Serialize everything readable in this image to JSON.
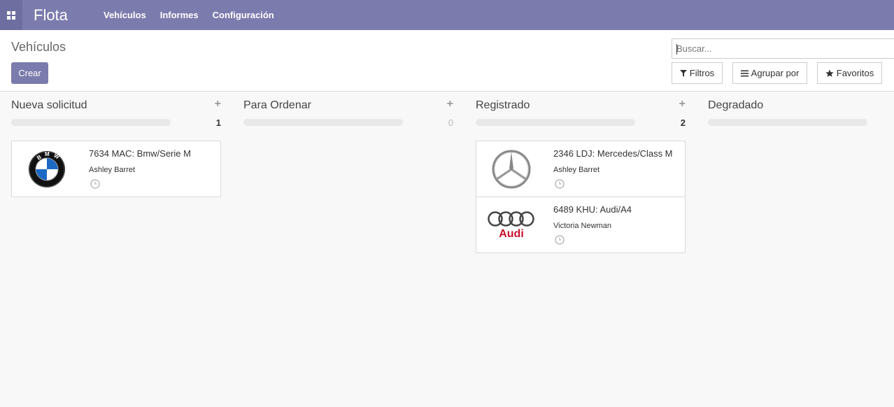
{
  "app": {
    "brand": "Flota",
    "menu": [
      "Vehículos",
      "Informes",
      "Configuración"
    ]
  },
  "control_panel": {
    "breadcrumb": "Vehículos",
    "create_label": "Crear",
    "search_placeholder": "Buscar...",
    "filters_label": "Filtros",
    "group_by_label": "Agrupar por",
    "favorites_label": "Favoritos"
  },
  "colors": {
    "navbar": "#7c7bad",
    "primary_button": "#7c7bad"
  },
  "columns": [
    {
      "title": "Nueva solicitud",
      "count": "1",
      "cards": [
        {
          "title": "7634 MAC: Bmw/Serie M",
          "driver": "Ashley Barret",
          "logo": "bmw-logo"
        }
      ]
    },
    {
      "title": "Para Ordenar",
      "count": "0",
      "cards": []
    },
    {
      "title": "Registrado",
      "count": "2",
      "cards": [
        {
          "title": "2346 LDJ: Mercedes/Class M",
          "driver": "Ashley Barret",
          "logo": "mercedes-logo"
        },
        {
          "title": "6489 KHU: Audi/A4",
          "driver": "Victoria Newman",
          "logo": "audi-logo"
        }
      ]
    },
    {
      "title": "Degradado",
      "count": "",
      "cards": []
    }
  ]
}
